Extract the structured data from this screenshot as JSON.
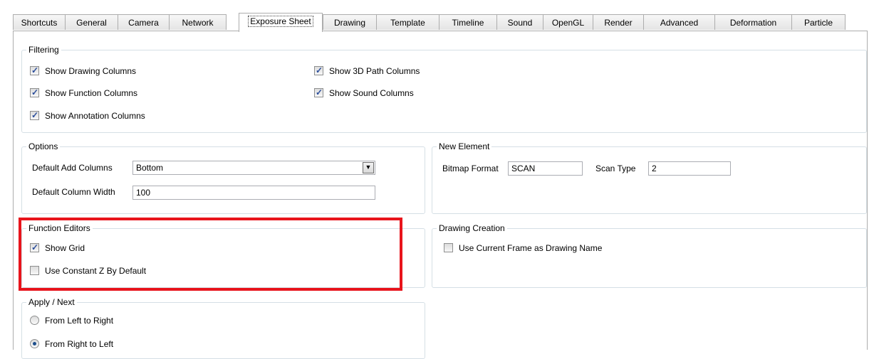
{
  "tabs": [
    "Shortcuts",
    "General",
    "Camera",
    "Network",
    "Exposure Sheet",
    "Drawing",
    "Template",
    "Timeline",
    "Sound",
    "OpenGL",
    "Render",
    "Advanced",
    "Deformation",
    "Particle"
  ],
  "active_tab": "Exposure Sheet",
  "filtering": {
    "title": "Filtering",
    "show_drawing_columns": "Show Drawing Columns",
    "show_function_columns": "Show Function Columns",
    "show_annotation_columns": "Show Annotation Columns",
    "show_3d_path_columns": "Show 3D Path Columns",
    "show_sound_columns": "Show Sound Columns"
  },
  "options": {
    "title": "Options",
    "default_add_columns_label": "Default Add Columns",
    "default_add_columns_value": "Bottom",
    "default_column_width_label": "Default Column Width",
    "default_column_width_value": "100"
  },
  "new_element": {
    "title": "New Element",
    "bitmap_format_label": "Bitmap Format",
    "bitmap_format_value": "SCAN",
    "scan_type_label": "Scan Type",
    "scan_type_value": "2"
  },
  "function_editors": {
    "title": "Function Editors",
    "show_grid": "Show Grid",
    "use_constant_z": "Use Constant Z By Default"
  },
  "drawing_creation": {
    "title": "Drawing Creation",
    "use_current_frame": "Use Current Frame as Drawing Name"
  },
  "apply_next": {
    "title": "Apply / Next",
    "left_to_right": "From Left to Right",
    "right_to_left": "From Right to Left"
  },
  "colors": {
    "highlight": "#e8141c",
    "group_border": "#d5dfe5",
    "checkmark": "#2a4d9b"
  }
}
